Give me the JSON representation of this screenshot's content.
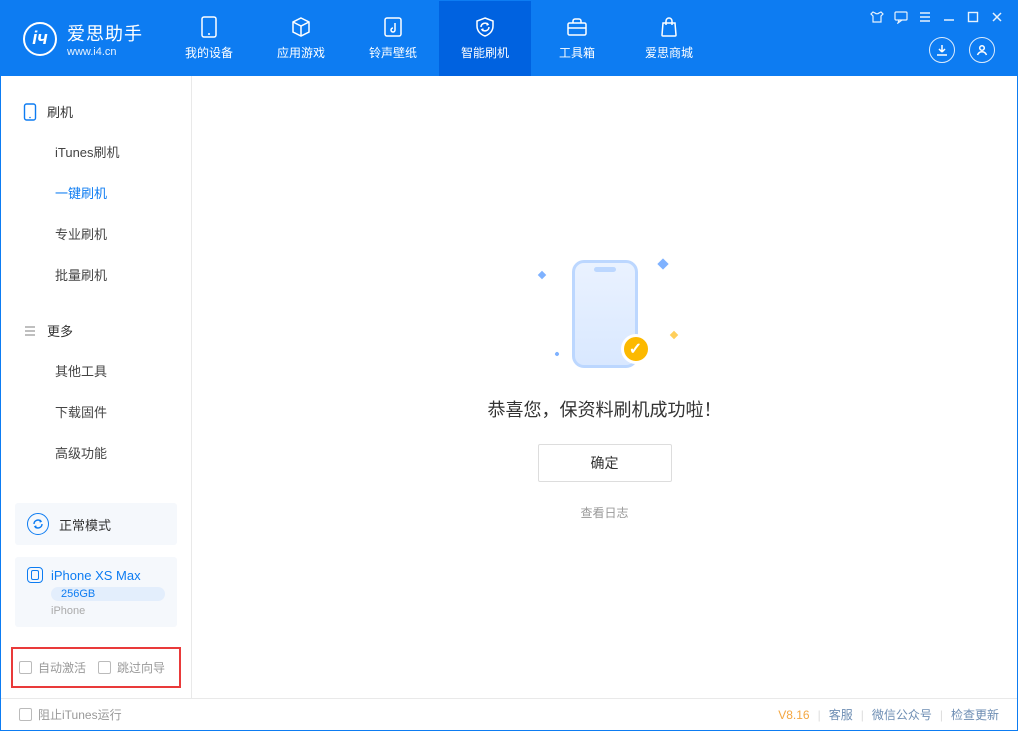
{
  "app": {
    "name_cn": "爱思助手",
    "name_en": "www.i4.cn"
  },
  "nav": {
    "items": [
      {
        "label": "我的设备"
      },
      {
        "label": "应用游戏"
      },
      {
        "label": "铃声壁纸"
      },
      {
        "label": "智能刷机"
      },
      {
        "label": "工具箱"
      },
      {
        "label": "爱思商城"
      }
    ],
    "active_index": 3
  },
  "sidebar": {
    "group1": {
      "title": "刷机",
      "items": [
        "iTunes刷机",
        "一键刷机",
        "专业刷机",
        "批量刷机"
      ],
      "active_index": 1
    },
    "group2": {
      "title": "更多",
      "items": [
        "其他工具",
        "下载固件",
        "高级功能"
      ]
    },
    "mode": "正常模式",
    "device": {
      "name": "iPhone XS Max",
      "storage": "256GB",
      "type": "iPhone"
    },
    "checks": {
      "auto_activate": "自动激活",
      "skip_guide": "跳过向导"
    }
  },
  "main": {
    "success_msg": "恭喜您，保资料刷机成功啦！",
    "ok": "确定",
    "view_log": "查看日志"
  },
  "footer": {
    "block_itunes": "阻止iTunes运行",
    "version": "V8.16",
    "links": [
      "客服",
      "微信公众号",
      "检查更新"
    ]
  }
}
